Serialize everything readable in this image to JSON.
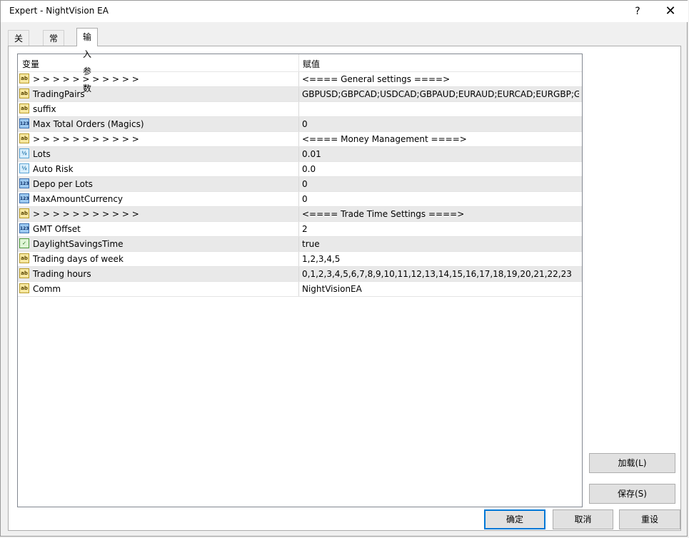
{
  "window": {
    "title": "Expert - NightVision EA",
    "help": "?",
    "close": "✕"
  },
  "tabs": [
    {
      "label": "关于"
    },
    {
      "label": "常用"
    },
    {
      "label": "输入参数"
    }
  ],
  "grid": {
    "headers": {
      "variable": "变量",
      "value": "赋值"
    },
    "rows": [
      {
        "icon": "ab",
        "name": ">  >  >  >  >  >  >  >  >  >  >",
        "value": "<==== General settings ====>"
      },
      {
        "icon": "ab",
        "name": "TradingPairs",
        "value": "GBPUSD;GBPCAD;USDCAD;GBPAUD;EURAUD;EURCAD;EURGBP;G..."
      },
      {
        "icon": "ab",
        "name": "suffix",
        "value": ""
      },
      {
        "icon": "123",
        "name": "Max Total Orders (Magics)",
        "value": "0"
      },
      {
        "icon": "ab",
        "name": ">  >  >  >  >  >  >  >  >  >  >",
        "value": "<==== Money Management ====>"
      },
      {
        "icon": "v2",
        "name": "Lots",
        "value": "0.01"
      },
      {
        "icon": "v2",
        "name": "Auto Risk",
        "value": "0.0"
      },
      {
        "icon": "123",
        "name": "Depo per Lots",
        "value": "0"
      },
      {
        "icon": "123",
        "name": "MaxAmountCurrency",
        "value": "0"
      },
      {
        "icon": "ab",
        "name": ">  >  >  >  >  >  >  >  >  >  >",
        "value": "<==== Trade Time Settings ====>"
      },
      {
        "icon": "123",
        "name": "GMT Offset",
        "value": "2"
      },
      {
        "icon": "bool",
        "name": "DaylightSavingsTime",
        "value": "true"
      },
      {
        "icon": "ab",
        "name": "Trading days of week",
        "value": "1,2,3,4,5"
      },
      {
        "icon": "ab",
        "name": "Trading hours",
        "value": "0,1,2,3,4,5,6,7,8,9,10,11,12,13,14,15,16,17,18,19,20,21,22,23"
      },
      {
        "icon": "ab",
        "name": "Comm",
        "value": "NightVisionEA"
      }
    ]
  },
  "buttons": {
    "load": "加载(L)",
    "save": "保存(S)",
    "ok": "确定",
    "cancel": "取消",
    "reset": "重设"
  }
}
